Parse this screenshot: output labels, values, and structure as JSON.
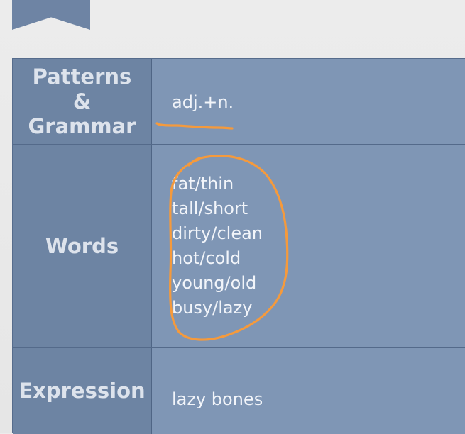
{
  "table": {
    "rows": [
      {
        "label_lines": [
          "Patterns",
          "&",
          "Grammar"
        ],
        "content": "adj.+n."
      },
      {
        "label_lines": [
          "Words"
        ],
        "content_items": [
          "fat/thin",
          "tall/short",
          "dirty/clean",
          "hot/cold",
          "young/old",
          "busy/lazy"
        ]
      },
      {
        "label_lines": [
          "Expression"
        ],
        "content": "lazy bones"
      }
    ]
  },
  "colors": {
    "label_background": "#6d84a3",
    "content_background": "#7f96b5",
    "annotation": "#f59a3c",
    "bookmark": "#6e84a4"
  }
}
